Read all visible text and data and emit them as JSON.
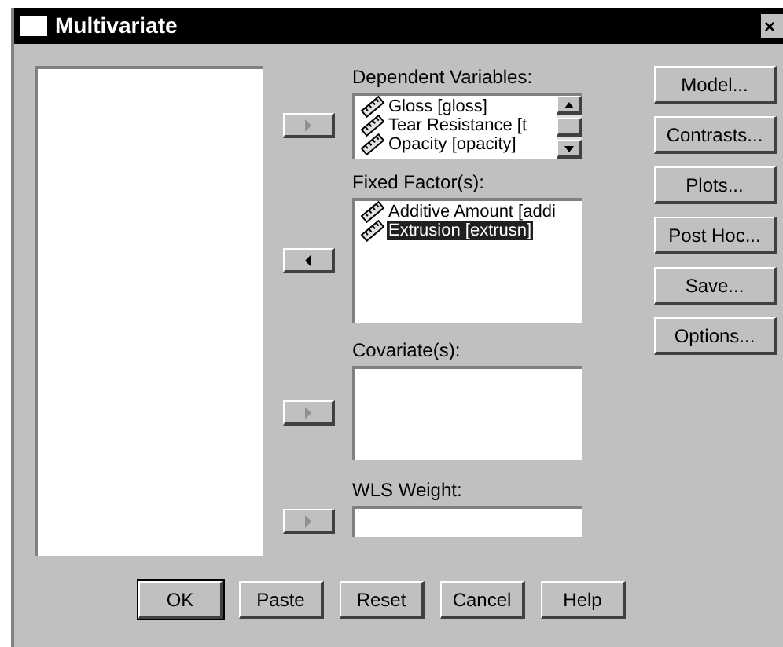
{
  "window": {
    "title": "Multivariate",
    "close": "×"
  },
  "target_lists": [
    {
      "kind": "list",
      "label": "Dependent Variables:",
      "arrow": {
        "kind": "right",
        "disabled": true
      },
      "scrollbar": true,
      "items": [
        {
          "label": "Gloss [gloss]",
          "selected": false
        },
        {
          "label": "Tear Resistance [t",
          "selected": false
        },
        {
          "label": "Opacity [opacity]",
          "selected": false
        }
      ]
    },
    {
      "kind": "list",
      "label": "Fixed Factor(s):",
      "arrow": {
        "kind": "left",
        "disabled": false
      },
      "scrollbar": false,
      "items": [
        {
          "label": "Additive Amount [addi",
          "selected": false
        },
        {
          "label": "Extrusion [extrusn]",
          "selected": true
        }
      ]
    },
    {
      "kind": "list",
      "label": "Covariate(s):",
      "arrow": {
        "kind": "right",
        "disabled": true
      },
      "scrollbar": false
    },
    {
      "kind": "field",
      "label": "WLS Weight:",
      "arrow": {
        "kind": "right",
        "disabled": true
      }
    }
  ],
  "side_buttons": [
    {
      "label": "Model..."
    },
    {
      "label": "Contrasts..."
    },
    {
      "label": "Plots..."
    },
    {
      "label": "Post Hoc..."
    },
    {
      "label": "Save..."
    },
    {
      "label": "Options..."
    }
  ],
  "bottom_buttons": [
    {
      "label": "OK",
      "default": true
    },
    {
      "label": "Paste",
      "default": false
    },
    {
      "label": "Reset",
      "default": false
    },
    {
      "label": "Cancel",
      "default": false
    },
    {
      "label": "Help",
      "default": false
    }
  ]
}
